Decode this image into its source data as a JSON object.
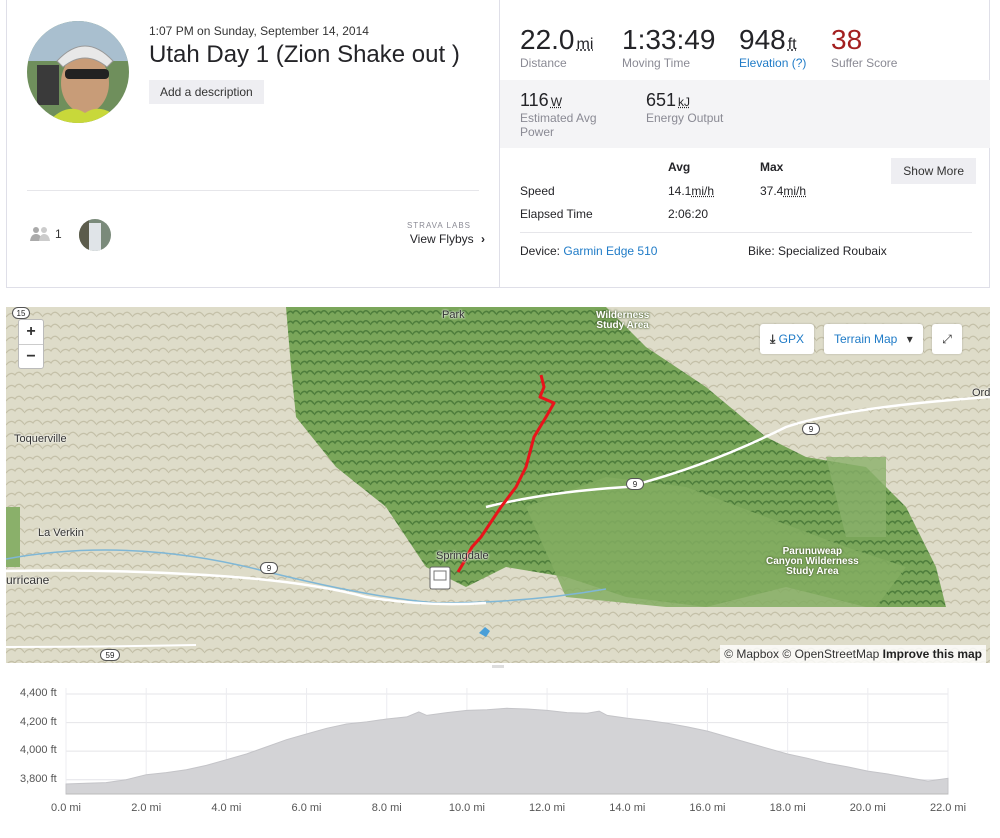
{
  "activity": {
    "datetime": "1:07 PM on Sunday, September 14, 2014",
    "title": "Utah Day 1 (Zion Shake out )",
    "add_description": "Add a description"
  },
  "social": {
    "kudos_count": "1",
    "labs_label": "STRAVA LABS",
    "flyby_label": "View Flybys"
  },
  "stats": {
    "distance": {
      "value": "22.0",
      "unit": "mi",
      "label": "Distance"
    },
    "moving_time": {
      "value": "1:33:49",
      "label": "Moving Time"
    },
    "elevation": {
      "value": "948",
      "unit": "ft",
      "label": "Elevation (?)"
    },
    "suffer": {
      "value": "38",
      "label": "Suffer Score"
    },
    "power": {
      "value": "116",
      "unit": "W",
      "label": "Estimated Avg Power"
    },
    "energy": {
      "value": "651",
      "unit": "kJ",
      "label": "Energy Output"
    }
  },
  "more_stats": {
    "col_avg": "Avg",
    "col_max": "Max",
    "show_more": "Show More",
    "speed": {
      "label": "Speed",
      "avg": "14.1",
      "avg_unit": "mi/h",
      "max": "37.4",
      "max_unit": "mi/h"
    },
    "elapsed": {
      "label": "Elapsed Time",
      "avg": "2:06:20"
    }
  },
  "gear": {
    "device_label": "Device:",
    "device": "Garmin Edge 510",
    "bike_label": "Bike:",
    "bike": "Specialized Roubaix"
  },
  "map": {
    "gpx": "GPX",
    "map_type": "Terrain Map",
    "zoom_in": "+",
    "zoom_out": "−",
    "attr_mapbox": "© Mapbox",
    "attr_osm": "© OpenStreetMap",
    "attr_improve": "Improve this map",
    "labels": {
      "park": "Park",
      "wilderness_top": "Wilderness\nStudy Area",
      "toquerville": "Toquerville",
      "la_verkin": "La Verkin",
      "hurricane": "urricane",
      "springdale": "Springdale",
      "parunuweap": "Parunuweap\nCanyon Wilderness\nStudy Area",
      "ord": "Ord"
    },
    "shields": [
      "15",
      "9",
      "9",
      "9",
      "59"
    ]
  },
  "elevation_chart": {
    "type": "area",
    "y_ticks": [
      "4,400 ft",
      "4,200 ft",
      "4,000 ft",
      "3,800 ft"
    ],
    "x_ticks": [
      "0.0 mi",
      "2.0 mi",
      "4.0 mi",
      "6.0 mi",
      "8.0 mi",
      "10.0 mi",
      "12.0 mi",
      "14.0 mi",
      "16.0 mi",
      "18.0 mi",
      "20.0 mi",
      "22.0 mi"
    ]
  },
  "chart_data": {
    "type": "area",
    "x_unit": "mi",
    "y_unit": "ft",
    "xlim": [
      0,
      22
    ],
    "ylim": [
      3700,
      4400
    ],
    "x": [
      0,
      0.5,
      1,
      1.5,
      2,
      2.5,
      3,
      3.5,
      4,
      4.5,
      5,
      5.5,
      6,
      6.5,
      7,
      7.5,
      8,
      8.5,
      8.8,
      9,
      9.5,
      10,
      10.5,
      11,
      11.5,
      12,
      12.5,
      13,
      13.3,
      13.5,
      14,
      14.5,
      15,
      15.5,
      16,
      16.5,
      17,
      17.5,
      18,
      18.5,
      19,
      19.5,
      20,
      20.5,
      21,
      21.5,
      22
    ],
    "y": [
      3770,
      3775,
      3780,
      3800,
      3835,
      3850,
      3870,
      3900,
      3940,
      3980,
      4030,
      4080,
      4120,
      4160,
      4190,
      4205,
      4225,
      4240,
      4275,
      4250,
      4270,
      4285,
      4290,
      4300,
      4295,
      4285,
      4270,
      4265,
      4280,
      4250,
      4230,
      4215,
      4195,
      4170,
      4140,
      4100,
      4060,
      4020,
      3980,
      3950,
      3915,
      3890,
      3860,
      3840,
      3815,
      3790,
      3810
    ],
    "grid": true
  }
}
